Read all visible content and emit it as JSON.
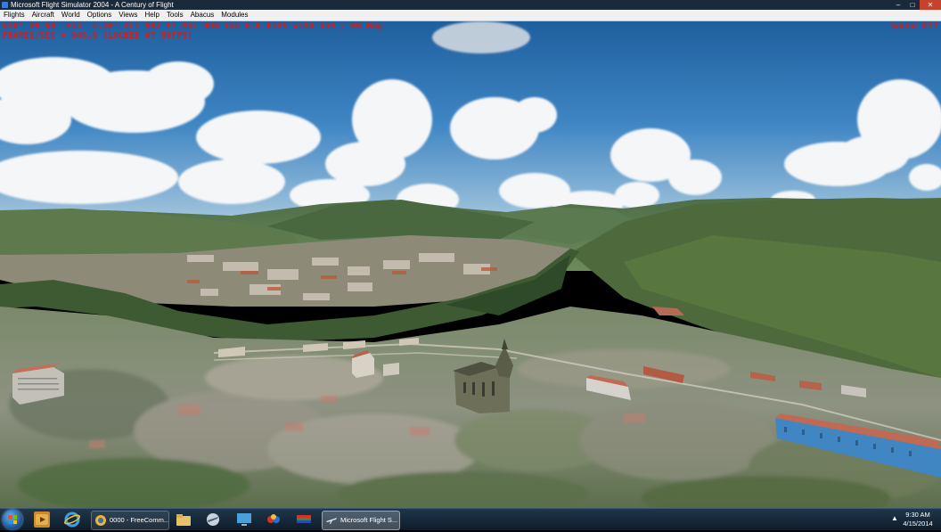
{
  "window": {
    "title": "Microsoft Flight Simulator 2004 - A Century of Flight",
    "minimize": "–",
    "maximize": "□",
    "close": "✕"
  },
  "menu": [
    "Flights",
    "Aircraft",
    "World",
    "Options",
    "Views",
    "Help",
    "Tools",
    "Abacus",
    "Modules"
  ],
  "hud": {
    "line1": "N50° 39.68'  E14° 2.30'  ALT  992 FT  MSL  HDG 146   0.0 KIAS  WIND 359 / 00 Mag",
    "line2": "FRAMES/SEC = 049.9 (LOCKED AT 50FPS)",
    "sound": "Sound Off",
    "color": "#d41c1c"
  },
  "taskbar": {
    "tasks": [
      {
        "label": "0000 - FreeComm...",
        "icon": "freecomm-icon"
      },
      {
        "label": "Microsoft Flight S...",
        "icon": "airplane-icon"
      }
    ],
    "pinned": [
      "media-player-icon",
      "internet-explorer-icon",
      "file-explorer-icon",
      "flight-app-icon",
      "remote-desktop-icon",
      "paint-icon",
      "flag-app-icon"
    ],
    "time": "9:30 AM",
    "date": "4/15/2014"
  }
}
